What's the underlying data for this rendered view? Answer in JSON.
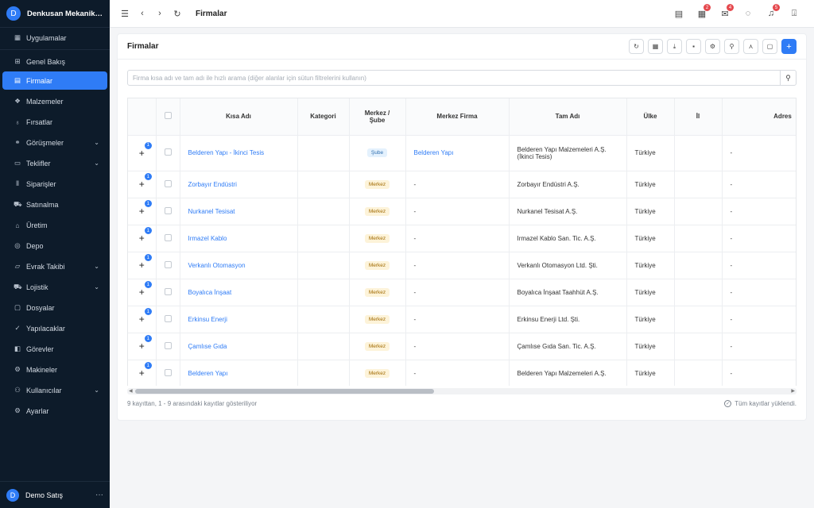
{
  "brand": {
    "initial": "D",
    "name": "Denkusan Mekanik San..."
  },
  "sidebar": {
    "items": [
      {
        "label": "Uygulamalar",
        "icon": "grid-icon",
        "glyph": "▦"
      },
      {
        "label": "Genel Bakış",
        "icon": "dashboard-icon",
        "glyph": "⊞"
      },
      {
        "label": "Firmalar",
        "icon": "building-icon",
        "glyph": "▤",
        "active": true
      },
      {
        "label": "Malzemeler",
        "icon": "boxes-icon",
        "glyph": "❖"
      },
      {
        "label": "Fırsatlar",
        "icon": "lightbulb-icon",
        "glyph": "♁"
      },
      {
        "label": "Görüşmeler",
        "icon": "handshake-icon",
        "glyph": "⚭",
        "expand": true
      },
      {
        "label": "Teklifler",
        "icon": "document-icon",
        "glyph": "▭",
        "expand": true
      },
      {
        "label": "Siparişler",
        "icon": "clipboard-icon",
        "glyph": "⫴"
      },
      {
        "label": "Satınalma",
        "icon": "cart-icon",
        "glyph": "⛟"
      },
      {
        "label": "Üretim",
        "icon": "factory-icon",
        "glyph": "⌂"
      },
      {
        "label": "Depo",
        "icon": "warehouse-icon",
        "glyph": "◎"
      },
      {
        "label": "Evrak Takibi",
        "icon": "folder-open-icon",
        "glyph": "▱",
        "expand": true
      },
      {
        "label": "Lojistik",
        "icon": "truck-icon",
        "glyph": "⛟",
        "expand": true
      },
      {
        "label": "Dosyalar",
        "icon": "folder-icon",
        "glyph": "▢"
      },
      {
        "label": "Yapılacaklar",
        "icon": "check-icon",
        "glyph": "✓"
      },
      {
        "label": "Görevler",
        "icon": "tasks-icon",
        "glyph": "◧"
      },
      {
        "label": "Makineler",
        "icon": "machine-icon",
        "glyph": "⚙"
      },
      {
        "label": "Kullanıcılar",
        "icon": "users-icon",
        "glyph": "⚇",
        "expand": true
      },
      {
        "label": "Ayarlar",
        "icon": "settings-icon",
        "glyph": "⚙"
      }
    ]
  },
  "user": {
    "initial": "D",
    "name": "Demo Satış"
  },
  "topbar": {
    "title": "Firmalar",
    "badges": {
      "calendar": "2",
      "mail": "4",
      "bell": "5"
    }
  },
  "card": {
    "title": "Firmalar",
    "search_placeholder": "Firma kısa adı ve tam adı ile hızlı arama (diğer alanlar için sütun filtrelerini kullanın)"
  },
  "table": {
    "headers": {
      "kisa_adi": "Kısa Adı",
      "kategori": "Kategori",
      "merkez_sube_1": "Merkez /",
      "merkez_sube_2": "Şube",
      "merkez_firma": "Merkez Firma",
      "tam_adi": "Tam Adı",
      "ulke": "Ülke",
      "il": "İl",
      "adres": "Adres"
    },
    "rows": [
      {
        "count": "1",
        "kisa_adi": "Belderen Yapı - İkinci Tesis",
        "kategori": "",
        "tip": "Şube",
        "tip_kind": "sube",
        "merkez_firma": "Belderen Yapı",
        "merkez_link": true,
        "tam_adi_1": "Belderen Yapı Malzemeleri A.Ş.",
        "tam_adi_2": "(İkinci Tesis)",
        "ulke": "Türkiye",
        "il": "",
        "adres": "-"
      },
      {
        "count": "1",
        "kisa_adi": "Zorbayır Endüstri",
        "kategori": "",
        "tip": "Merkez",
        "tip_kind": "merkez",
        "merkez_firma": "-",
        "tam_adi_1": "Zorbayır Endüstri A.Ş.",
        "tam_adi_2": "",
        "ulke": "Türkiye",
        "il": "",
        "adres": "-"
      },
      {
        "count": "1",
        "kisa_adi": "Nurkanel Tesisat",
        "kategori": "",
        "tip": "Merkez",
        "tip_kind": "merkez",
        "merkez_firma": "-",
        "tam_adi_1": "Nurkanel Tesisat A.Ş.",
        "tam_adi_2": "",
        "ulke": "Türkiye",
        "il": "",
        "adres": "-"
      },
      {
        "count": "1",
        "kisa_adi": "Irmazel Kablo",
        "kategori": "",
        "tip": "Merkez",
        "tip_kind": "merkez",
        "merkez_firma": "-",
        "tam_adi_1": "Irmazel Kablo San. Tic. A.Ş.",
        "tam_adi_2": "",
        "ulke": "Türkiye",
        "il": "",
        "adres": "-"
      },
      {
        "count": "1",
        "kisa_adi": "Verkanlı Otomasyon",
        "kategori": "",
        "tip": "Merkez",
        "tip_kind": "merkez",
        "merkez_firma": "-",
        "tam_adi_1": "Verkanlı Otomasyon Ltd. Şti.",
        "tam_adi_2": "",
        "ulke": "Türkiye",
        "il": "",
        "adres": "-"
      },
      {
        "count": "1",
        "kisa_adi": "Boyalıca İnşaat",
        "kategori": "",
        "tip": "Merkez",
        "tip_kind": "merkez",
        "merkez_firma": "-",
        "tam_adi_1": "Boyalıca İnşaat Taahhüt A.Ş.",
        "tam_adi_2": "",
        "ulke": "Türkiye",
        "il": "",
        "adres": "-"
      },
      {
        "count": "1",
        "kisa_adi": "Erkinsu Enerji",
        "kategori": "",
        "tip": "Merkez",
        "tip_kind": "merkez",
        "merkez_firma": "-",
        "tam_adi_1": "Erkinsu Enerji Ltd. Şti.",
        "tam_adi_2": "",
        "ulke": "Türkiye",
        "il": "",
        "adres": "-"
      },
      {
        "count": "1",
        "kisa_adi": "Çamlıse Gıda",
        "kategori": "",
        "tip": "Merkez",
        "tip_kind": "merkez",
        "merkez_firma": "-",
        "tam_adi_1": "Çamlıse Gıda San. Tic. A.Ş.",
        "tam_adi_2": "",
        "ulke": "Türkiye",
        "il": "",
        "adres": "-"
      },
      {
        "count": "1",
        "kisa_adi": "Belderen Yapı",
        "kategori": "",
        "tip": "Merkez",
        "tip_kind": "merkez",
        "merkez_firma": "-",
        "tam_adi_1": "Belderen Yapı Malzemeleri A.Ş.",
        "tam_adi_2": "",
        "ulke": "Türkiye",
        "il": "",
        "adres": "-"
      }
    ]
  },
  "footer": {
    "info": "9 kayıttan, 1 - 9 arasındaki kayıtlar gösteriliyor",
    "status": "Tüm kayıtlar yüklendi."
  }
}
